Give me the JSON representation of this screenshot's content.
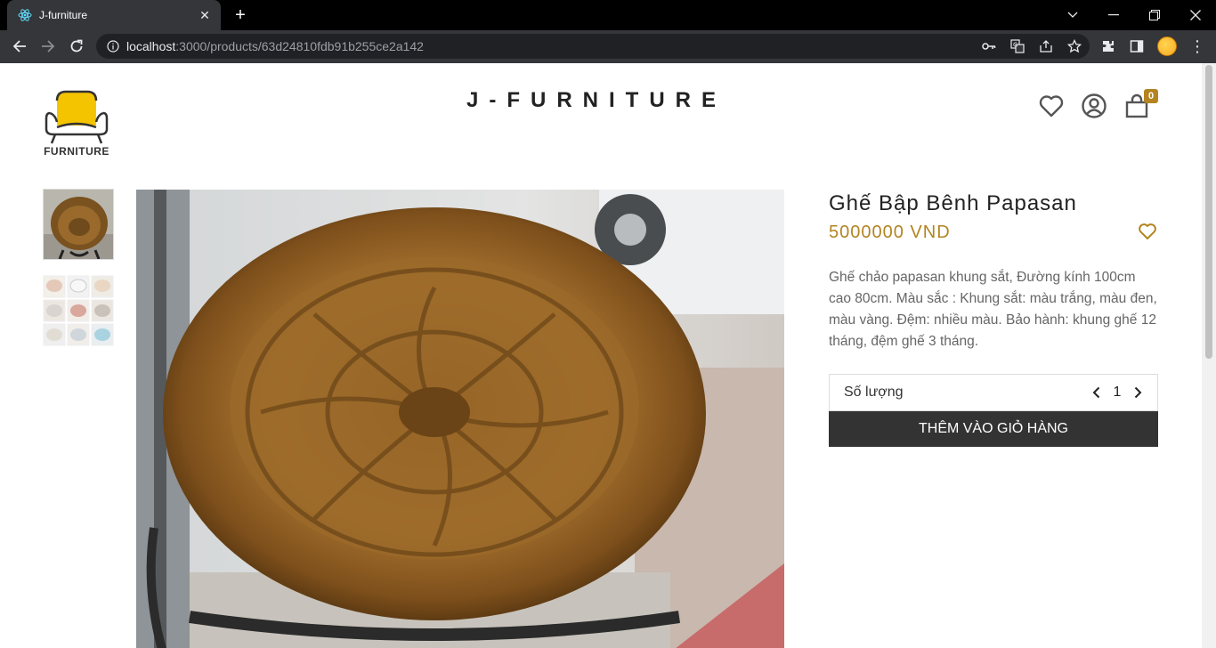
{
  "browser": {
    "tab_title": "J-furniture",
    "url_host": "localhost",
    "url_rest": ":3000/products/63d24810fdb91b255ce2a142"
  },
  "header": {
    "logo_text": "FURNITURE",
    "brand": "J-FURNITURE",
    "cart_count": "0"
  },
  "product": {
    "name": "Ghế Bập Bênh Papasan",
    "price": "5000000 VND",
    "description": "Ghế chảo papasan khung sắt, Đường kính 100cm cao 80cm. Màu sắc : Khung sắt: màu trắng, màu đen, màu vàng. Đệm: nhiều màu. Bảo hành: khung ghế 12 tháng, đệm ghế 3 tháng.",
    "quantity_label": "Số lượng",
    "quantity": "1",
    "add_to_cart_label": "THÊM VÀO GIỎ HÀNG"
  },
  "colors": {
    "accent": "#b38420",
    "button_dark": "#333333",
    "logo_yellow": "#f5c400"
  }
}
